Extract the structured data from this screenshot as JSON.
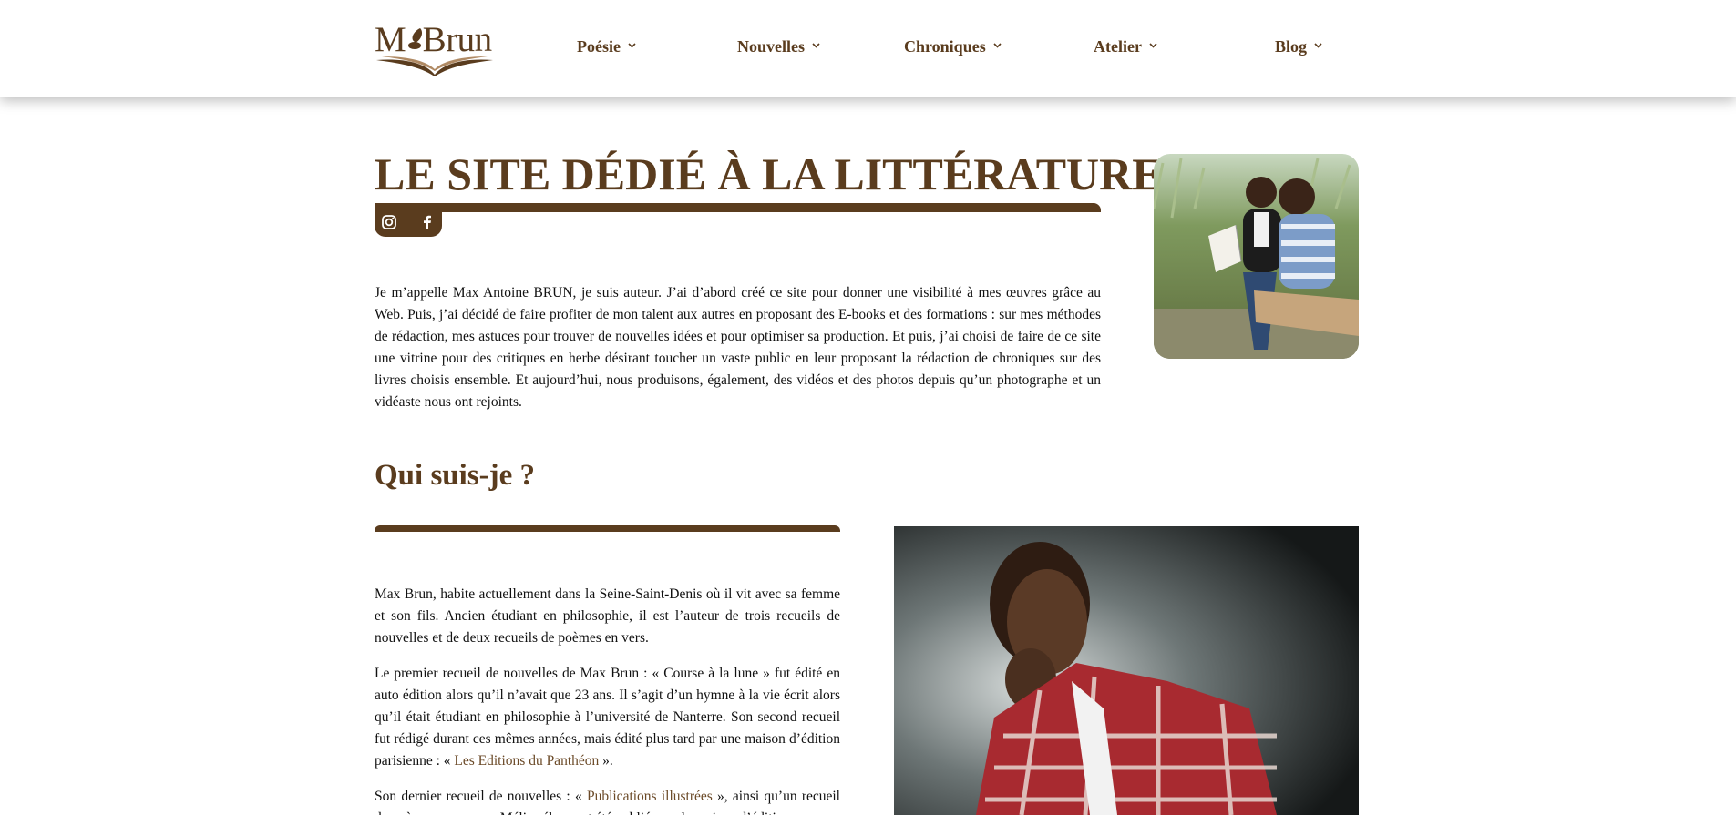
{
  "header": {
    "logo_text": "M  Brun",
    "nav": [
      {
        "label": "Poésie"
      },
      {
        "label": "Nouvelles"
      },
      {
        "label": "Chroniques"
      },
      {
        "label": "Atelier"
      },
      {
        "label": "Blog"
      }
    ],
    "chevron": "⌄"
  },
  "hero": {
    "title": "LE SITE DÉDIÉ À LA LITTÉRATURE",
    "social": [
      "instagram-icon",
      "facebook-icon"
    ],
    "intro": "Je m’appelle Max Antoine BRUN, je suis auteur. J’ai d’abord créé ce site pour donner une visibilité à mes œuvres grâce au Web. Puis, j’ai décidé de faire profiter de mon talent aux autres en proposant des E-books et des formations : sur mes méthodes de rédaction, mes astuces pour trouver de nouvelles idées et pour optimiser sa production. Et puis, j’ai choisi de faire de ce site une vitrine pour des critiques en herbe désirant toucher un vaste public en leur proposant la rédaction de chroniques sur des livres choisis ensemble. Et aujourd’hui, nous produisons, également, des vidéos et des photos depuis qu’un photographe et un vidéaste nous ont rejoints."
  },
  "about": {
    "title": "Qui suis-je ?",
    "p1": "Max Brun, habite actuellement dans la Seine-Saint-Denis où il vit avec sa femme et son fils. Ancien étudiant en philosophie, il est l’auteur de trois recueils de nouvelles et de deux recueils de poèmes en vers.",
    "p2_before": "Le premier recueil de nouvelles de Max Brun : « Course à la lune » fut édité en auto édition alors qu’il n’avait que 23 ans. Il s’agit d’un hymne à la vie écrit alors qu’il était étudiant en philosophie à l’université de Nanterre. Son second recueil fut rédigé durant ces mêmes années, mais édité plus tard par une maison d’édition parisienne : « ",
    "p2_link": "Les Editions du Panthéon",
    "p2_after": " ».",
    "p3_before": "Son dernier recueil de nouvelles : « ",
    "p3_link": "Publications illustrées",
    "p3_after": " », ainsi qu’un recueil de poèmes en vers : « Méli-mélo » ont été publiés par la maison d’édition."
  },
  "colors": {
    "brand_brown": "#5a3c1e",
    "link_brown": "#6b4a28"
  }
}
